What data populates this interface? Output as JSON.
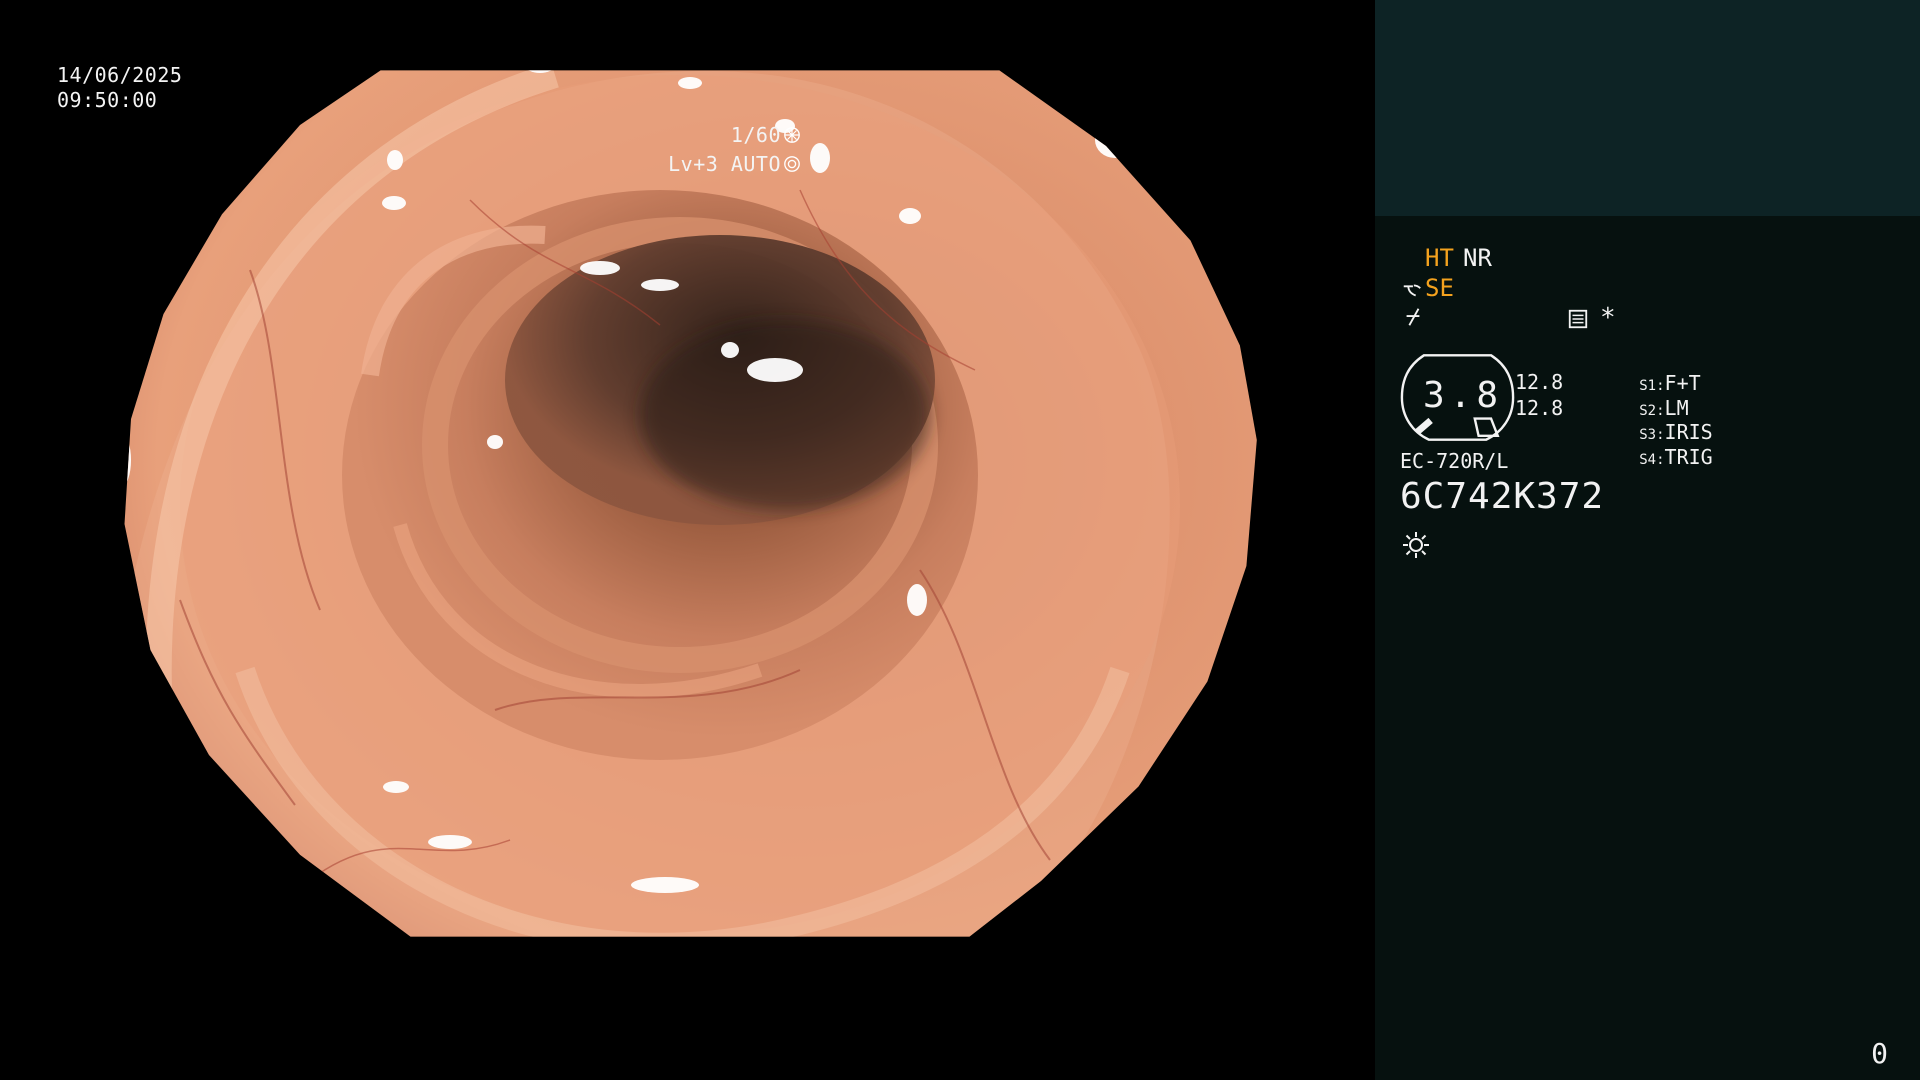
{
  "scope_view": {
    "date": "14/06/2025",
    "time": "09:50:00",
    "shutter": "1/60",
    "shutter_icon": "shutter-icon",
    "level": "Lv+3 AUTO",
    "auto_icon": "auto-exposure-icon",
    "image_subject": "colon-lumen-endoscopy"
  },
  "info_panel": {
    "status": {
      "ht": "HT",
      "nr": "NR",
      "se": "SE"
    },
    "mode_icons": [
      "scope-mode-icon",
      "flash-icon"
    ],
    "record_icon": "record-settings-icon",
    "asterisk": "*",
    "gauge": {
      "value": "3.8",
      "left_value": "12.8",
      "right_value": "12.8"
    },
    "switches": [
      {
        "key": "S1:",
        "label": "F+T"
      },
      {
        "key": "S2:",
        "label": "LM"
      },
      {
        "key": "S3:",
        "label": "IRIS"
      },
      {
        "key": "S4:",
        "label": "TRIG"
      }
    ],
    "scope_model": "EC-720R/L",
    "serial": "6C742K372",
    "light_icon": "light-icon",
    "counter": "0"
  },
  "colors": {
    "panel_background": "#06110f",
    "panel_header": "#0d2325",
    "amber": "#f4a21e",
    "text": "#f3f3f3",
    "mucosa": "#d8896a"
  }
}
